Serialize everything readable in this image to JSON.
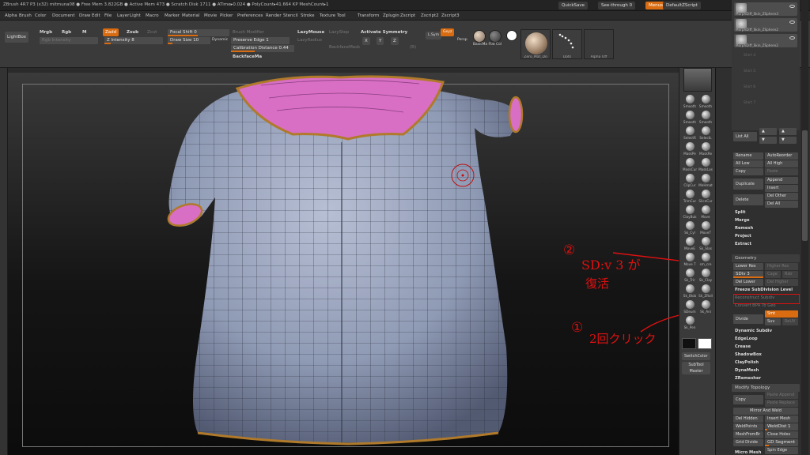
{
  "titlebar": {
    "text": "ZBrush 4R7 P3 (x32)   mitmuna08   ● Free Mem 3.822GB ● Active Mem 473 ● Scratch Disk 1711 ● ATime▸0.024 ● PolyCount▸41.664 KP   MeshCount▸1",
    "quicksave": "QuickSave",
    "seethrough": "See-through  0",
    "menus": "Menus",
    "script": "DefaultZScript"
  },
  "menubar": [
    "Alpha",
    "Brush",
    "Color",
    "Document",
    "Draw",
    "Edit",
    "File",
    "Layer",
    "Light",
    "Macro",
    "Marker",
    "Material",
    "Movie",
    "Picker",
    "Preferences",
    "Render",
    "Stencil",
    "Stroke",
    "Texture",
    "Tool",
    "Transform",
    "Zplugin",
    "Zscript",
    "Zscript2",
    "Zscript3"
  ],
  "shelf": {
    "lightbox": "LightBox",
    "mrgb": "Mrgb",
    "rgb": "Rgb",
    "m": "M",
    "zadd": "Zadd",
    "zsub": "Zsub",
    "zcut": "Zcut",
    "rgb_intensity": "Rgb  Intensity",
    "z_intensity": "Z Intensity 8",
    "focal_shift": "Focal Shift 0",
    "draw_size": "Draw Size 10",
    "dynamic": "Dynamic",
    "backface_hint": "Brush Modifier",
    "preserve_edge": "Preserve Edge 1",
    "calibration": "Calibration Distance 0.44",
    "backface_mask": "BackfaceMa",
    "lazymouse": "LazyMouse",
    "lazystep": "LazyStep",
    "lazyradius": "LazyRadius",
    "backfacemask2": "BackfaceMask",
    "activate_symmetry": "Activate Symmetry",
    "x": "X",
    "y": "Y",
    "z": "Z",
    "r": "(R)",
    "persp": "Persp",
    "floor": "Floor",
    "lsym": "L.Sym",
    "gxyz": "Gxyz",
    "material": "BasicMa Flat Col",
    "zero_mat": "zero_M",
    "brush_name": "Zero_Mat_Do",
    "dots": "Dots",
    "alpha_off": "Alpha Off",
    "texture_off": "Texture Off"
  },
  "subtools": [
    {
      "name": "MorphDiff_Skin_ZSphere3",
      "active": true
    },
    {
      "name": "MorphDiff_Skin_ZSphere2",
      "active": true
    },
    {
      "name": "MorphDiff_Skin_ZSphere2",
      "active": true
    },
    {
      "name": "Shirt 4",
      "active": false
    },
    {
      "name": "Shirt 5",
      "active": false
    },
    {
      "name": "Shirt 6",
      "active": false
    },
    {
      "name": "Shirt 7",
      "active": false
    }
  ],
  "tray": {
    "list_all": "List All",
    "rename": "Rename",
    "autoreorder": "AutoReorder",
    "all_low": "All Low",
    "all_high": "All High",
    "copy": "Copy",
    "paste": "Paste",
    "duplicate": "Duplicate",
    "append": "Append",
    "insert": "Insert",
    "delete": "Delete",
    "del_other": "Del Other",
    "del_all": "Del All",
    "split": "Split",
    "merge": "Merge",
    "remesh": "Remesh",
    "project": "Project",
    "extract": "Extract",
    "geometry": "Geometry",
    "lower_res": "Lower Res",
    "higher_res": "Higher Res",
    "sdiv": "SDiv 3",
    "cage": "Cage",
    "rstr": "Rstr",
    "del_lower": "Del Lower",
    "del_higher": "Del Higher",
    "freeze": "Freeze SubDivision Level",
    "reconstruct": "Reconstruct Subdiv",
    "convert_bpr": "Convert BPR To Geo",
    "divide": "Divide",
    "smt": "Smt",
    "suv": "Suv",
    "relt": "ReUV",
    "dynamic_subdiv": "Dynamic Subdiv",
    "edgeloop": "EdgeLoop",
    "crease": "Crease",
    "shadowbox": "ShadowBox",
    "claypolish": "ClayPolish",
    "dynamesh": "DynaMesh",
    "zremesher": "ZRemesher",
    "modify_topology": "Modify Topology",
    "copy2": "Copy",
    "paste_append": "Paste Append",
    "paste_replace": "Paste Replace",
    "mirror_weld": "Mirror And Weld",
    "del_hidden": "Del Hidden",
    "insert_mesh": "Insert Mesh",
    "weldpoints": "WeldPoints",
    "welddist": "WeldDist 1",
    "meshfrombrush": "MeshFromBr",
    "close_holes": "Close Holes",
    "grid_divide": "Grid Divide",
    "gd_segment": "GD Segment",
    "spin_edge": "Spin Edge",
    "micro_mesh": "Micro Mesh"
  },
  "rightcol": {
    "tools": [
      "Smooth",
      "Smooth",
      "Smooth",
      "Smooth",
      "SelectR",
      "SelectL",
      "MaskPe",
      "MaskRe",
      "MaskCur",
      "MaskLas",
      "ClipCur",
      "MeHmat",
      "TrimCur",
      "SliceCur",
      "ClayBuk",
      "Move",
      "Sk_Cyl",
      "MoveT",
      "MoveE",
      "Sk_Slas",
      "Move T",
      "sm_cre",
      "Sk_Trir",
      "Sk_Clay",
      "Sk_Blob",
      "Sk_ZRoll",
      "SDeum",
      "Sk_Ani",
      "Sk_Pen"
    ],
    "switch_color": "SwitchColor",
    "subtool_master": "SubTool Master"
  },
  "annotations": {
    "note2_num": "②",
    "note2_text": "SD:v 3 が",
    "note2_text2": "復活",
    "note1_num": "①",
    "note1_text": "2回クリック"
  },
  "colors": {
    "accent": "#d96b10",
    "annotation": "#e01010",
    "collar": "#d86fc4",
    "shirt": "#8f9ab4"
  }
}
